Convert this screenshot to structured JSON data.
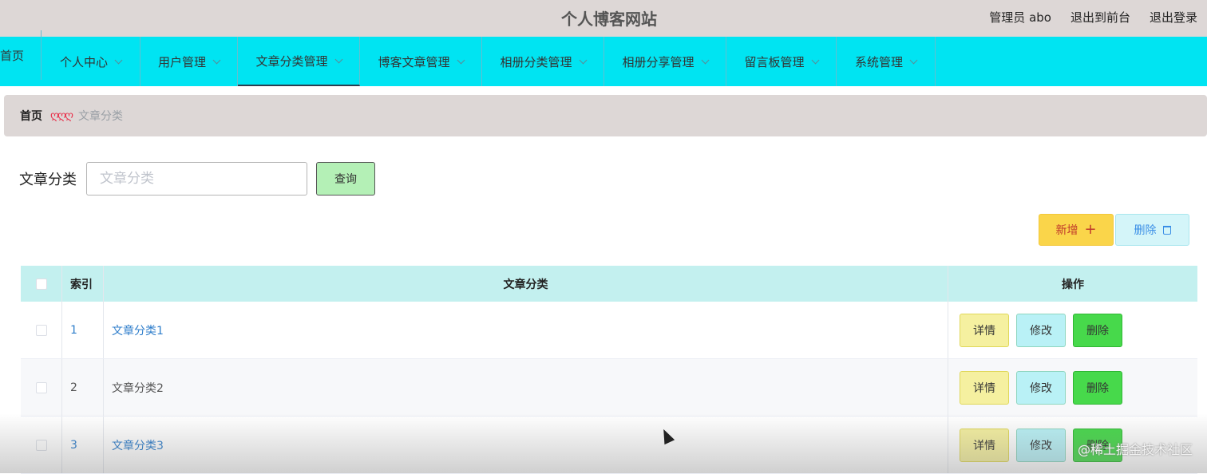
{
  "header": {
    "site_title": "个人博客网站",
    "admin_label": "管理员 abo",
    "exit_front": "退出到前台",
    "logout": "退出登录"
  },
  "nav": {
    "home": "首页",
    "items": [
      {
        "label": "个人中心"
      },
      {
        "label": "用户管理"
      },
      {
        "label": "文章分类管理"
      },
      {
        "label": "博客文章管理"
      },
      {
        "label": "相册分类管理"
      },
      {
        "label": "相册分享管理"
      },
      {
        "label": "留言板管理"
      },
      {
        "label": "系统管理"
      }
    ],
    "active": "文章分类管理"
  },
  "breadcrumb": {
    "home": "首页",
    "current": "文章分类"
  },
  "search": {
    "label": "文章分类",
    "placeholder": "文章分类",
    "query_button": "查询"
  },
  "actions": {
    "add": "新增",
    "delete": "删除"
  },
  "table": {
    "columns": {
      "index": "索引",
      "name": "文章分类",
      "ops": "操作"
    },
    "rows": [
      {
        "index": "1",
        "name": "文章分类1"
      },
      {
        "index": "2",
        "name": "文章分类2"
      },
      {
        "index": "3",
        "name": "文章分类3"
      }
    ],
    "op_labels": {
      "detail": "详情",
      "edit": "修改",
      "delete": "删除"
    }
  },
  "watermark": "@稀土掘金技术社区",
  "colors": {
    "nav_bg": "#00e4f2",
    "header_bg": "#ddd7d6",
    "table_head": "#c3f0ef",
    "add_btn": "#fad54a",
    "delete_op": "#47d94b"
  }
}
